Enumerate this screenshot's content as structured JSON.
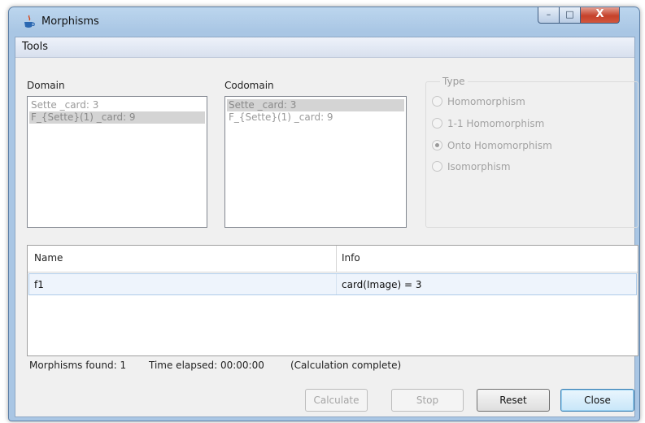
{
  "window": {
    "title": "Morphisms",
    "controls": {
      "minimize": "–",
      "maximize": "□",
      "close": "X"
    }
  },
  "menu": {
    "tools": "Tools"
  },
  "domain": {
    "label": "Domain",
    "items": [
      {
        "text": "Sette _card: 3",
        "selected": false
      },
      {
        "text": "F_{Sette}(1) _card: 9",
        "selected": true
      }
    ]
  },
  "codomain": {
    "label": "Codomain",
    "items": [
      {
        "text": "Sette _card: 3",
        "selected": true
      },
      {
        "text": "F_{Sette}(1) _card: 9",
        "selected": false
      }
    ]
  },
  "type": {
    "label": "Type",
    "options": [
      {
        "label": "Homomorphism",
        "checked": false
      },
      {
        "label": "1-1 Homomorphism",
        "checked": false
      },
      {
        "label": "Onto Homomorphism",
        "checked": true
      },
      {
        "label": "Isomorphism",
        "checked": false
      }
    ]
  },
  "results": {
    "columns": [
      "Name",
      "Info"
    ],
    "rows": [
      {
        "name": "f1",
        "info": "card(Image) = 3"
      }
    ]
  },
  "status": {
    "found": "Morphisms found: 1",
    "elapsed": "Time elapsed: 00:00:00",
    "state": "(Calculation complete)"
  },
  "buttons": {
    "calculate": "Calculate",
    "stop": "Stop",
    "reset": "Reset",
    "close": "Close"
  },
  "icons": {
    "app": "java-coffee-cup-icon"
  }
}
